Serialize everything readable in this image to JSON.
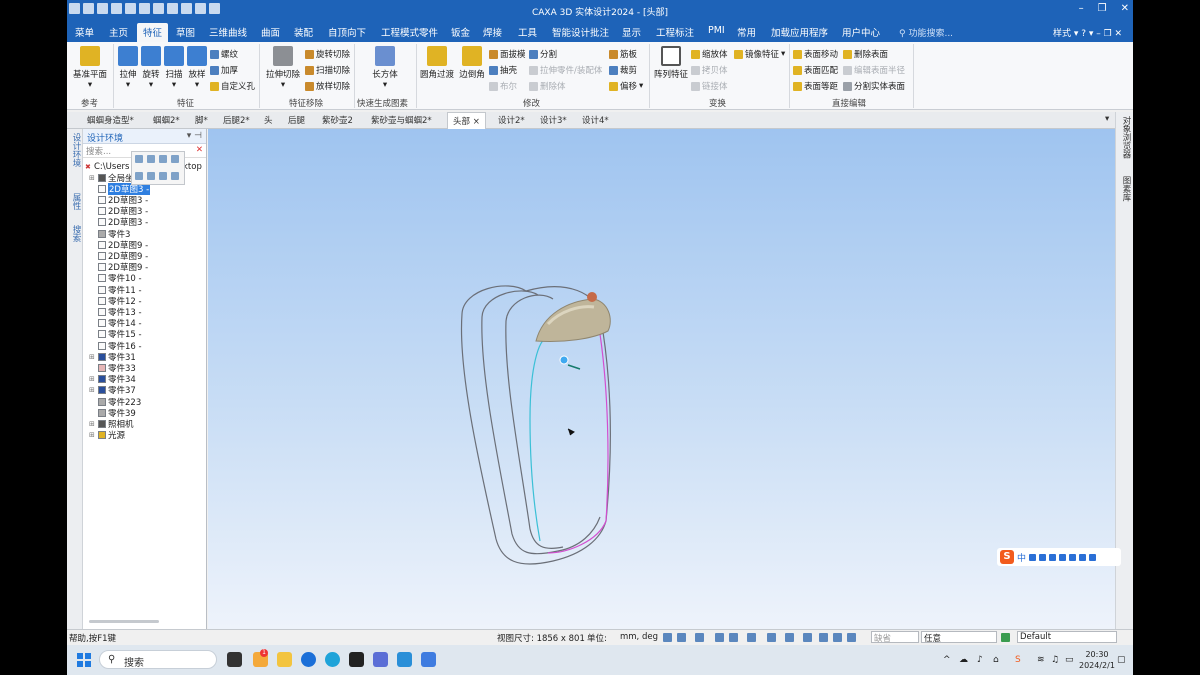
{
  "window": {
    "title": "CAXA 3D 实体设计2024 - [头部]"
  },
  "menu": {
    "tabs": [
      "菜单",
      "主页",
      "特征",
      "草图",
      "三维曲线",
      "曲面",
      "装配",
      "自顶向下",
      "工程模式零件",
      "钣金",
      "焊接",
      "工具",
      "智能设计批注",
      "显示",
      "工程标注",
      "PMI",
      "常用",
      "加载应用程序",
      "用户中心"
    ],
    "active": "特征",
    "search_placeholder": "功能搜索...",
    "style_label": "样式"
  },
  "ribbon": {
    "ref": {
      "big": [
        "基准平面"
      ],
      "group": "参考"
    },
    "feature": {
      "big": [
        "拉伸",
        "旋转",
        "扫描",
        "放样"
      ],
      "small": [
        "螺纹",
        "加厚",
        "自定义孔"
      ],
      "group": "特征"
    },
    "remove": {
      "big": [
        "拉伸切除"
      ],
      "small": [
        "旋转切除",
        "扫描切除",
        "放样切除"
      ],
      "group": "特征移除"
    },
    "quick": {
      "big": [
        "长方体"
      ],
      "group": "快速生成图素"
    },
    "modify": {
      "big": [
        "圆角过渡",
        "边倒角"
      ],
      "small": [
        "面拔模",
        "分割",
        "抽壳",
        "拉伸零件/装配体",
        "布尔",
        "删除体",
        "筋板",
        "裁剪",
        "偏移"
      ],
      "group": "修改"
    },
    "transform": {
      "big": [
        "阵列特征"
      ],
      "small": [
        "缩放体",
        "镜像特征",
        "拷贝体",
        "链接体"
      ],
      "group": "变换"
    },
    "direct": {
      "small": [
        "表面移动",
        "删除表面",
        "表面匹配",
        "编辑表面半径",
        "表面等距",
        "分割实体表面"
      ],
      "group": "直接编辑"
    }
  },
  "doc_tabs": [
    "蝈蝈身造型*",
    "蝈蝈2*",
    "脚*",
    "后腿2*",
    "头",
    "后腿",
    "紫砂壶2",
    "紫砂壶与蝈蝈2*",
    "头部",
    "设计2*",
    "设计3*",
    "设计4*"
  ],
  "doc_tabs_active": "头部",
  "left_strip": [
    "设计环境",
    "属性",
    "搜索"
  ],
  "panel": {
    "title": "设计环境",
    "search_placeholder": "搜索...",
    "path": "C:\\Users",
    "path_tail": "ktop",
    "items": [
      {
        "label": "全局坐标",
        "type": "axis"
      },
      {
        "label": "2D草图3 -",
        "type": "sketch",
        "selected": true
      },
      {
        "label": "2D草图3 -",
        "type": "sketch"
      },
      {
        "label": "2D草图3 -",
        "type": "sketch"
      },
      {
        "label": "2D草图3 -",
        "type": "sketch"
      },
      {
        "label": "零件3",
        "type": "part"
      },
      {
        "label": "2D草图9 -",
        "type": "sketch"
      },
      {
        "label": "2D草图9 -",
        "type": "sketch"
      },
      {
        "label": "2D草图9 -",
        "type": "sketch"
      },
      {
        "label": "零件10 -",
        "type": "sketch"
      },
      {
        "label": "零件11 -",
        "type": "sketch"
      },
      {
        "label": "零件12 -",
        "type": "sketch"
      },
      {
        "label": "零件13 -",
        "type": "sketch"
      },
      {
        "label": "零件14 -",
        "type": "sketch"
      },
      {
        "label": "零件15 -",
        "type": "sketch"
      },
      {
        "label": "零件16 -",
        "type": "sketch"
      },
      {
        "label": "零件31",
        "type": "solid"
      },
      {
        "label": "零件33",
        "type": "surface"
      },
      {
        "label": "零件34",
        "type": "solid"
      },
      {
        "label": "零件37",
        "type": "solid"
      },
      {
        "label": "零件223",
        "type": "part"
      },
      {
        "label": "零件39",
        "type": "part"
      },
      {
        "label": "照相机",
        "type": "camera"
      },
      {
        "label": "光源",
        "type": "light"
      }
    ]
  },
  "right_strip": [
    "对象浏览器",
    "图素库"
  ],
  "ime": {
    "label": "中"
  },
  "status": {
    "help": "帮助,按F1键",
    "view_size_label": "视图尺寸: 1856 x 801",
    "units_label": "单位:",
    "units_value": "mm, deg",
    "field_missing": "缺省",
    "any": "任意",
    "default": "Default"
  },
  "taskbar": {
    "search_placeholder": "搜索",
    "time": "20:30",
    "date": "2024/2/1",
    "badge": "1"
  },
  "colors": {
    "titlebar": "#1e63b8",
    "accent": "#2f7fe0",
    "viewport_top": "#9fc4f0",
    "viewport_bottom": "#eef3fb"
  }
}
